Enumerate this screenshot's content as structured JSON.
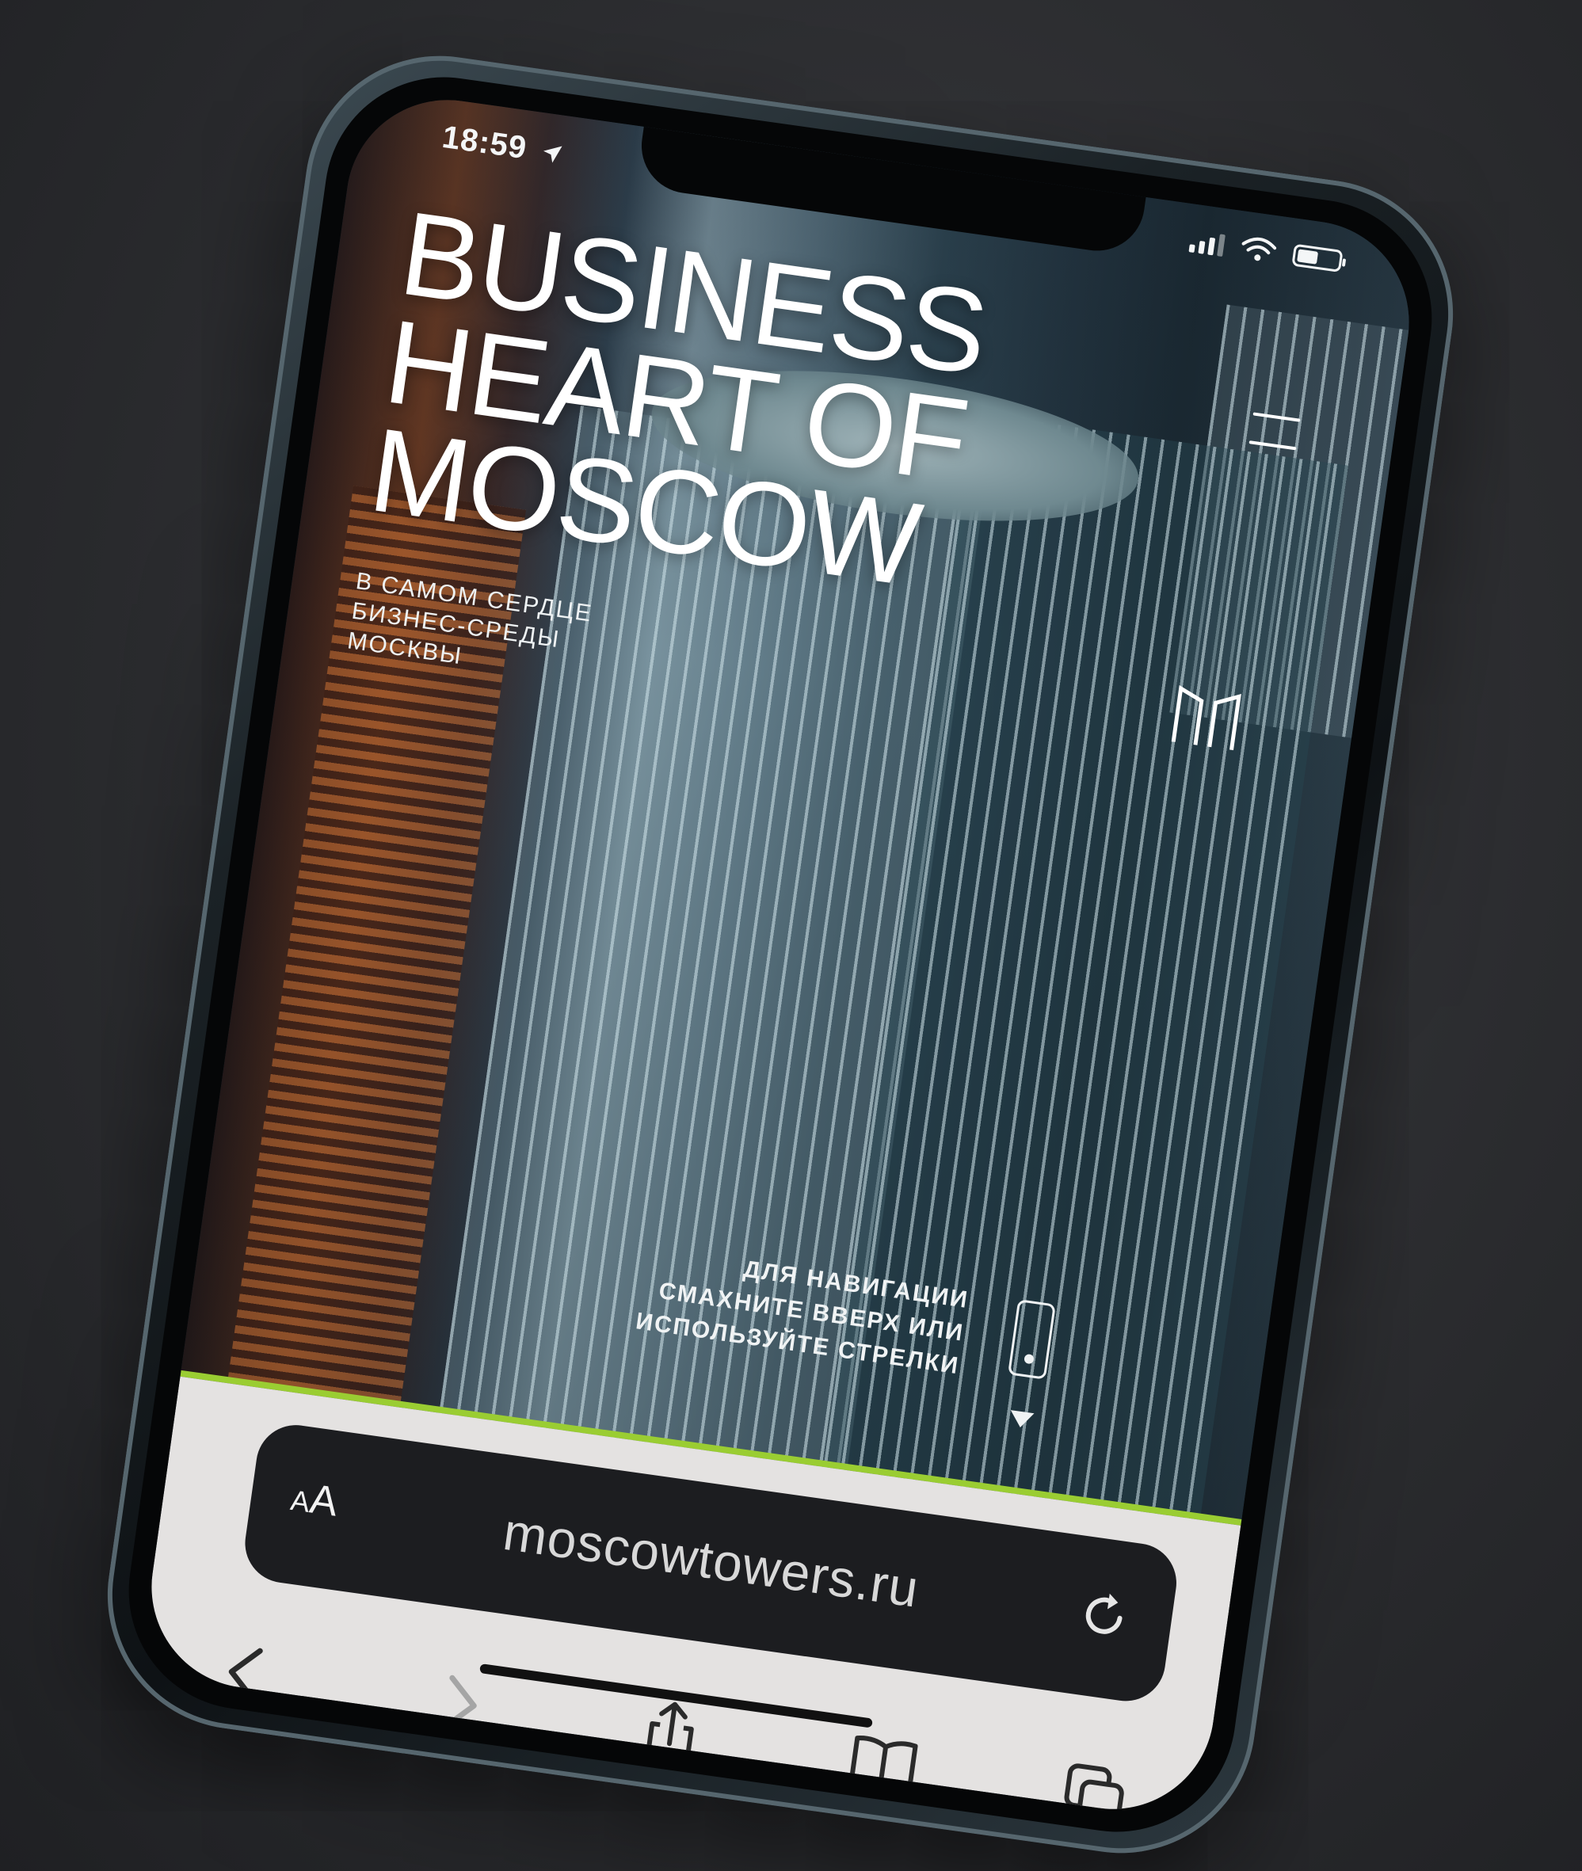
{
  "status_bar": {
    "time": "18:59",
    "battery_level": 0.55
  },
  "page": {
    "title_lines": [
      "BUSINESS",
      "HEART OF",
      "MOSCOW"
    ],
    "subtitle": "В САМОМ СЕРДЦЕ БИЗНЕС-СРЕДЫ МОСКВЫ",
    "navigation_hint": "ДЛЯ НАВИГАЦИИ СМАХНИТЕ ВВЕРХ ИЛИ ИСПОЛЬЗУЙТЕ СТРЕЛКИ"
  },
  "browser": {
    "text_size_label_small": "A",
    "text_size_label_large": "A",
    "url": "moscowtowers.ru"
  },
  "colors": {
    "accent": "#9acd32",
    "toolbar_background": "#e4e2e1",
    "address_bar_background": "#1c1d20"
  },
  "icons": {
    "location": "location-arrow-icon",
    "signal": "cellular-signal-icon",
    "wifi": "wifi-icon",
    "battery": "battery-icon",
    "menu": "hamburger-menu-icon",
    "logo": "brand-logo-icon",
    "swipe": "swipe-phone-icon",
    "down": "down-arrow-icon",
    "reload": "reload-icon",
    "back": "back-chevron-icon",
    "forward": "forward-chevron-icon",
    "share": "share-icon",
    "bookmarks": "bookmarks-icon",
    "tabs": "tabs-icon"
  }
}
